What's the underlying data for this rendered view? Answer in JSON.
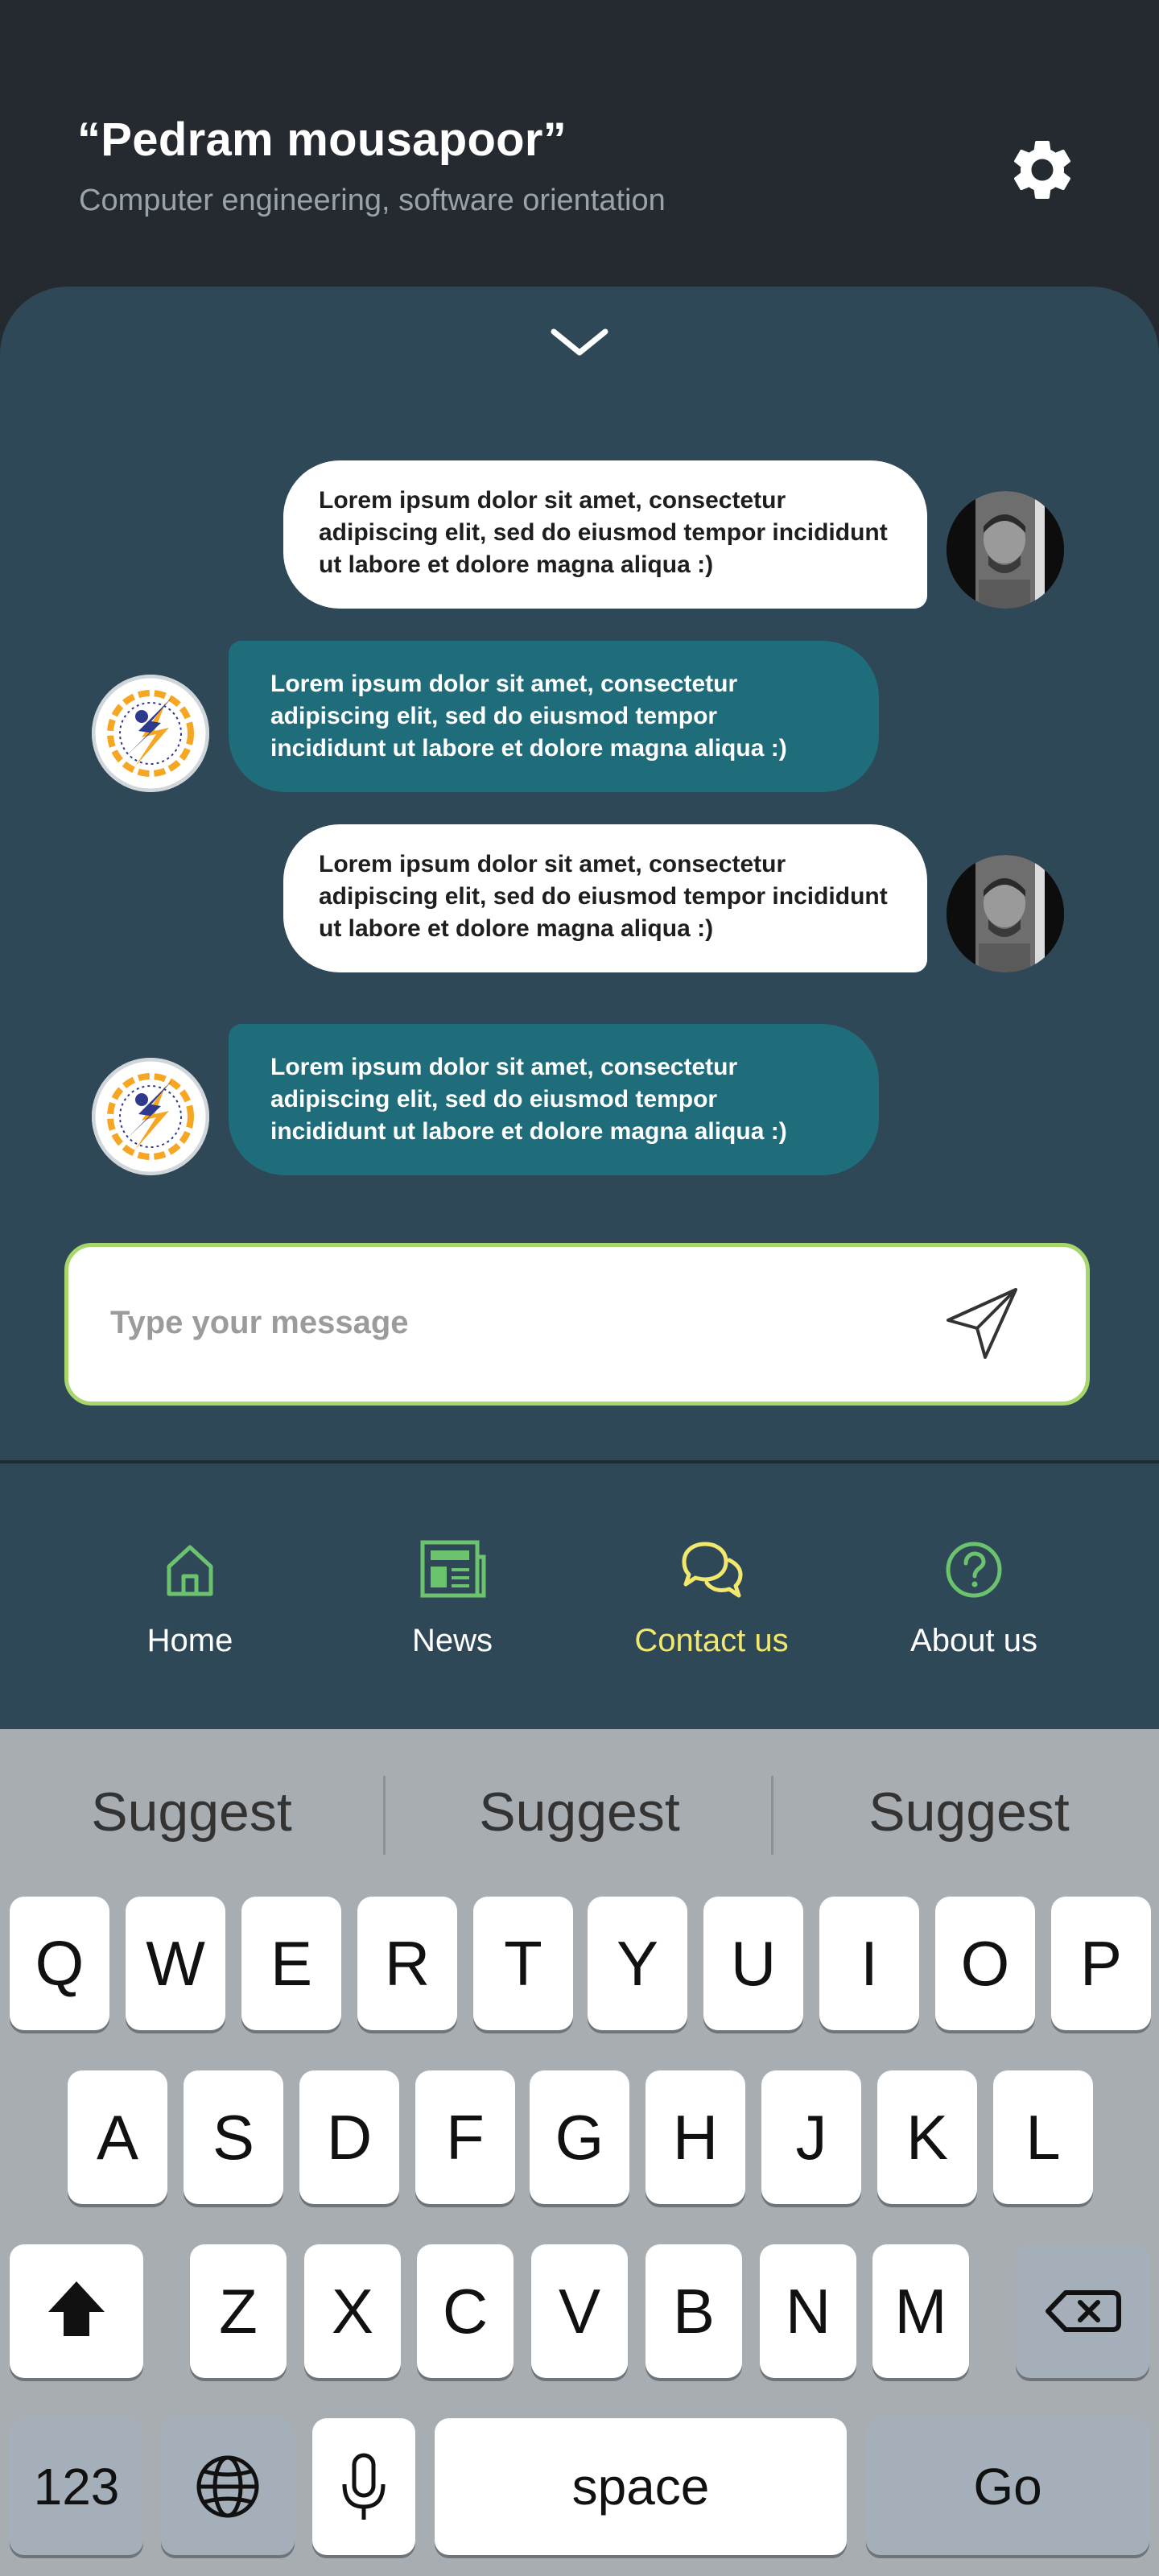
{
  "header": {
    "title": "“Pedram mousapoor”",
    "subtitle": "Computer engineering, software orientation"
  },
  "chat": {
    "messages": [
      {
        "from": "user",
        "text": "Lorem ipsum dolor sit amet, consectetur adipiscing elit, sed do eiusmod tempor incididunt ut labore et dolore magna aliqua :)"
      },
      {
        "from": "bot",
        "text": "Lorem ipsum dolor sit amet, consectetur adipiscing elit, sed do eiusmod tempor incididunt ut labore et dolore magna aliqua :)"
      },
      {
        "from": "user",
        "text": "Lorem ipsum dolor sit amet, consectetur adipiscing elit, sed do eiusmod tempor incididunt ut labore et dolore magna aliqua :)"
      },
      {
        "from": "bot",
        "text": "Lorem ipsum dolor sit amet, consectetur adipiscing elit, sed do eiusmod tempor incididunt ut labore et dolore magna aliqua :)"
      }
    ]
  },
  "composer": {
    "placeholder": "Type your message"
  },
  "nav": {
    "items": [
      {
        "label": "Home",
        "icon": "home-icon",
        "active": false
      },
      {
        "label": "News",
        "icon": "newspaper-icon",
        "active": false
      },
      {
        "label": "Contact us",
        "icon": "chat-bubbles-icon",
        "active": true
      },
      {
        "label": "About us",
        "icon": "help-circle-icon",
        "active": false
      }
    ]
  },
  "colors": {
    "background": "#242a2f",
    "panel": "#2f4858",
    "bot_bubble": "#1f6c7b",
    "icon_green": "#6cc36e",
    "active_yellow": "#f2e86d",
    "input_border": "#a7d76b",
    "keyboard": "#a8adb2"
  },
  "keyboard": {
    "suggestions": [
      "Suggest",
      "Suggest",
      "Suggest"
    ],
    "row1": [
      "Q",
      "W",
      "E",
      "R",
      "T",
      "Y",
      "U",
      "I",
      "O",
      "P"
    ],
    "row2": [
      "A",
      "S",
      "D",
      "F",
      "G",
      "H",
      "J",
      "K",
      "L"
    ],
    "row3": [
      "Z",
      "X",
      "C",
      "V",
      "B",
      "N",
      "M"
    ],
    "numbers_label": "123",
    "space_label": "space",
    "go_label": "Go"
  }
}
